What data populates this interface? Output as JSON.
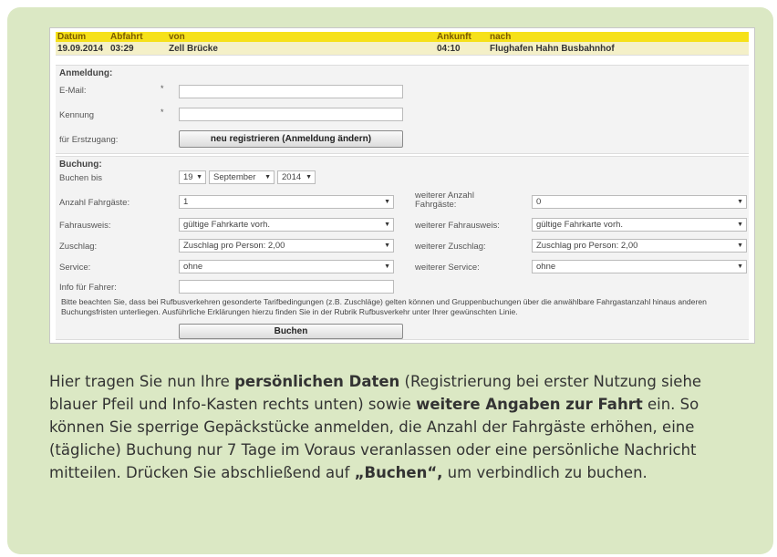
{
  "header": {
    "cols": {
      "datum": "Datum",
      "abfahrt": "Abfahrt",
      "von": "von",
      "ankunft": "Ankunft",
      "nach": "nach"
    },
    "values": {
      "datum": "19.09.2014",
      "abfahrt": "03:29",
      "von": "Zell Brücke",
      "ankunft": "04:10",
      "nach": "Flughafen Hahn Busbahnhof"
    }
  },
  "anmeldung": {
    "title": "Anmeldung:",
    "email_label": "E-Mail:",
    "kennung_label": "Kennung",
    "required_mark": "*",
    "erstzugang_label": "für Erstzugang:",
    "register_button": "neu registrieren (Anmeldung ändern)",
    "email_value": "",
    "kennung_value": ""
  },
  "buchung": {
    "title": "Buchung:",
    "buchen_bis_label": "Buchen bis",
    "day": "19",
    "month": "September",
    "year": "2014",
    "anzahl_label": "Anzahl Fahrgäste:",
    "anzahl_value": "1",
    "weitere_anzahl_label": "weiterer Anzahl Fahrgäste:",
    "weitere_anzahl_value": "0",
    "fahrausweis_label": "Fahrausweis:",
    "fahrausweis_value": "gültige Fahrkarte vorh.",
    "weiterer_fahrausweis_label": "weiterer Fahrausweis:",
    "weiterer_fahrausweis_value": "gültige Fahrkarte vorh.",
    "zuschlag_label": "Zuschlag:",
    "zuschlag_value": "Zuschlag pro Person: 2,00",
    "weiterer_zuschlag_label": "weiterer Zuschlag:",
    "weiterer_zuschlag_value": "Zuschlag pro Person: 2,00",
    "service_label": "Service:",
    "service_value": "ohne",
    "weiterer_service_label": "weiterer Service:",
    "weiterer_service_value": "ohne",
    "info_label": "Info für Fahrer:",
    "info_value": "",
    "note": "Bitte beachten Sie, dass bei Rufbusverkehren gesonderte Tarifbedingungen (z.B. Zuschläge) gelten können und Gruppenbuchungen über die anwählbare Fahrgastanzahl hinaus anderen Buchungsfristen unterliegen. Ausführliche Erklärungen hierzu finden Sie in der Rubrik Rufbusverkehr unter Ihrer gewünschten Linie.",
    "submit_button": "Buchen"
  },
  "caption": {
    "p1": "Hier tragen Sie nun Ihre ",
    "b1": "persönlichen Daten",
    "p2": " (Registrierung bei erster Nutzung siehe blauer Pfeil und Info-Kasten rechts unten) sowie ",
    "b2": "weitere Angaben zur Fahrt",
    "p3": " ein. So können Sie sperrige Gepäckstücke anmelden, die Anzahl der Fahrgäste erhöhen, eine (tägliche) Buchung nur 7 Tage im Voraus veranlassen oder eine persönliche Nachricht mitteilen. Drücken Sie abschließend auf ",
    "b3": "„Buchen“,",
    "p4": " um verbindlich zu buchen."
  },
  "icons": {
    "dropdown": "chevron-down-icon"
  },
  "colors": {
    "card": "#dbe8c4",
    "header_yellow": "#f6e11a"
  }
}
